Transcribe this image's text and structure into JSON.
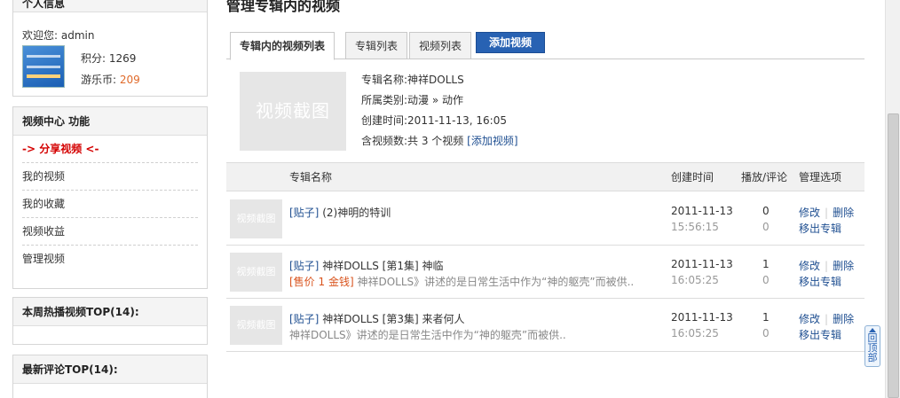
{
  "sidebar": {
    "profile": {
      "title": "个人信息",
      "welcome_label": "欢迎您:",
      "username": "admin",
      "points_label": "积分:",
      "points": "1269",
      "coins_label": "游乐币:",
      "coins": "209"
    },
    "video_center": {
      "title": "视频中心 功能",
      "items": [
        {
          "label": "-> 分享视频 <-"
        },
        {
          "label": "我的视频"
        },
        {
          "label": "我的收藏"
        },
        {
          "label": "视频收益"
        },
        {
          "label": "管理视频"
        }
      ]
    },
    "weekly_hot": {
      "title": "本周热播视频TOP(14):"
    },
    "latest_comments": {
      "title": "最新评论TOP(14):"
    }
  },
  "main": {
    "title": "管理专辑内的视频",
    "tabs": [
      {
        "label": "专辑内的视频列表"
      },
      {
        "label": "专辑列表"
      },
      {
        "label": "视频列表"
      }
    ],
    "add_video_button": "添加视频",
    "album": {
      "thumb_text": "视频截图",
      "name_label": "专辑名称:",
      "name": "神祥DOLLS",
      "category_label": "所属类别:",
      "category": "动漫 » 动作",
      "created_label": "创建时间:",
      "created": "2011-11-13, 16:05",
      "count_label": "含视频数:",
      "count_text": "共 3 个视频",
      "add_link": "[添加视频]"
    },
    "list": {
      "columns": {
        "name": "专辑名称",
        "created": "创建时间",
        "plays": "播放/评论",
        "ops": "管理选项"
      },
      "thumb_text": "视频截图",
      "edit_label": "修改",
      "delete_label": "删除",
      "move_label": "移出专辑",
      "rows": [
        {
          "tag": "[贴子]",
          "title": " (2)神明的特训",
          "price": "",
          "desc": "",
          "date": "2011-11-13",
          "time": "15:56:15",
          "plays": "0",
          "comments": "0"
        },
        {
          "tag": "[贴子]",
          "title": " 神祥DOLLS [第1集] 神临",
          "price": "[售价 1 金钱]",
          "desc": "  神祥DOLLS》讲述的是日常生活中作为“神的躯壳”而被供..",
          "date": "2011-11-13",
          "time": "16:05:25",
          "plays": "1",
          "comments": "0"
        },
        {
          "tag": "[贴子]",
          "title": " 神祥DOLLS [第3集] 来者何人",
          "price": "",
          "desc": "  神祥DOLLS》讲述的是日常生活中作为“神的躯壳”而被供..",
          "date": "2011-11-13",
          "time": "16:05:25",
          "plays": "1",
          "comments": "0"
        }
      ]
    }
  },
  "back_to_top": "回顶部",
  "colors": {
    "accent": "#2862b3",
    "active_menu": "#d40000",
    "price": "#d9541e",
    "coins": "#e06a2a"
  }
}
